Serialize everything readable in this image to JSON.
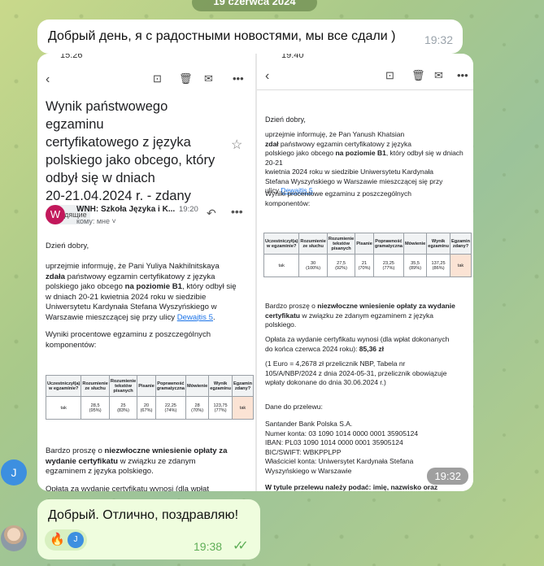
{
  "date_pill": "19 czerwca 2024",
  "messages": {
    "m1": {
      "text": "Добрый день, я с радостными новостями, мы все сдали )",
      "time": "19:32"
    },
    "photos_time": "19:32",
    "m2": {
      "text": "Добрый. Отлично, поздравляю!",
      "time": "19:38",
      "reaction_emoji": "🔥",
      "reaction_avatar": "J"
    }
  },
  "sender_avatar_letter": "J",
  "left_shot": {
    "status_time": "15:26",
    "subject_line1": "Wynik państwowego egzaminu",
    "subject_line2": "certyfikatowego z języka",
    "subject_line3": "polskiego jako obcego, który",
    "subject_line4": "odbył się w dniach",
    "subject_line5": "20-21.04.2024 r. - zdany",
    "label": "Входящие",
    "sender_initial": "W",
    "sender": "WNH: Szkoła Języka i K...",
    "time": "19:20",
    "to": "кому: мне",
    "greeting": "Dzień dobry,",
    "p1_a": "uprzejmie informuję, że Pani Yuliya Nakhilnitskaya",
    "p1_b": "zdała",
    "p1_c": " państwowy egzamin certyfikatowy z języka",
    "p1_d": "polskiego jako obcego ",
    "p1_e": "na poziomie B1",
    "p1_f": ", który odbył się",
    "p1_g": "w dniach 20-21 kwietnia 2024 roku w siedzibie",
    "p1_h": "Uniwersytetu Kardynała Stefana Wyszyńskiego w",
    "p1_i": "Warszawie mieszczącej się przy ulicy ",
    "p1_link": "Dewajtis 5",
    "p2_a": "Wyniki procentowe egzaminu z poszczególnych",
    "p2_b": "komponentów:",
    "table_headers": [
      "Uczestniczył(a) w egzaminie?",
      "Rozumienie ze słuchu",
      "Rozumienie tekstów pisanych",
      "Pisanie",
      "Poprawność gramatyczna",
      "Mówienie",
      "Wynik egzaminu",
      "Egzamin zdany?"
    ],
    "table_row": [
      "tak",
      "28,5",
      "25",
      "20",
      "22,25",
      "28",
      "123,75",
      "tak"
    ],
    "table_row_pct": [
      "",
      "(95%)",
      "(83%)",
      "(67%)",
      "(74%)",
      "(70%)",
      "(77%)",
      ""
    ],
    "p3_a": "Bardzo proszę o ",
    "p3_b": "niezwłoczne wniesienie opłaty za",
    "p3_c": "wydanie certyfikatu",
    "p3_d": " w związku ze zdanym",
    "p3_e": "egzaminem z języka polskiego.",
    "p4": "Opłata za wydanie certyfikatu wynosi (dla wpłat"
  },
  "right_shot": {
    "status_time": "19:40",
    "greeting": "Dzień dobry,",
    "p1_a": "uprzejmie informuję, że Pan Yanush Khatsian",
    "p1_b": "zdał",
    "p1_c": " państwowy egzamin certyfikatowy z języka",
    "p1_d": "polskiego jako obcego ",
    "p1_e": "na poziomie B1",
    "p1_f": ", który odbył się w dniach 20-21",
    "p1_g": "kwietnia 2024 roku w siedzibie Uniwersytetu Kardynała",
    "p1_h": "Stefana Wyszyńskiego w Warszawie mieszczącej się przy",
    "p1_i": "ulicy ",
    "p1_link": "Dewajtis 5",
    "p2_a": "Wyniki procentowe egzaminu z poszczególnych",
    "p2_b": "komponentów:",
    "table_headers": [
      "Uczestniczył(a) w egzaminie?",
      "Rozumienie ze słuchu",
      "Rozumienie tekstów pisanych",
      "Pisanie",
      "Poprawność gramatyczna",
      "Mówienie",
      "Wynik egzaminu",
      "Egzamin zdany?"
    ],
    "table_row": [
      "tak",
      "30",
      "27,5",
      "21",
      "23,25",
      "35,5",
      "137,25",
      "tak"
    ],
    "table_row_pct": [
      "",
      "(100%)",
      "(92%)",
      "(70%)",
      "(77%)",
      "(89%)",
      "(86%)",
      ""
    ],
    "p3_a": "Bardzo proszę o ",
    "p3_b": "niezwłoczne wniesienie opłaty za wydanie",
    "p3_c": "certyfikatu",
    "p3_d": " w związku ze zdanym egzaminem z języka",
    "p3_e": "polskiego.",
    "p4_a": "Opłata za wydanie certyfikatu wynosi (dla wpłat dokonanych",
    "p4_b": "do końca czerwca 2024 roku): ",
    "p4_c": "85,36 zł",
    "p5_a": "(1 Euro = 4,2678 zł przelicznik NBP, Tabela nr",
    "p5_b": "105/A/NBP/2024 z dnia 2024-05-31, przelicznik obowiązuje",
    "p5_c": "wpłaty dokonane do dnia 30.06.2024 r.)",
    "p6": "Dane do przelewu:",
    "bank_1": "Santander Bank Polska S.A.",
    "bank_2": "Numer konta: 03 1090 1014 0000 0001 35905124",
    "bank_3": "IBAN: PL03 1090 1014 0000 0001 35905124",
    "bank_4": "BIC/SWIFT: WBKPPLPP",
    "bank_5": "Właściciel konta: Uniwersytet Kardynała Stefana",
    "bank_6": "Wyszyńskiego w Warszawie",
    "p7": "W tytule przelewu należy podać: imię, nazwisko oraz"
  }
}
